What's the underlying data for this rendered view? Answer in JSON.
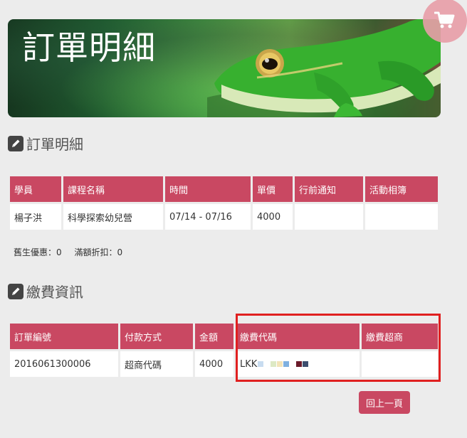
{
  "banner": {
    "title": "訂單明細"
  },
  "order_section": {
    "heading": "訂單明細",
    "columns": [
      "學員",
      "課程名稱",
      "時間",
      "單價",
      "行前通知",
      "活動相簿"
    ],
    "rows": [
      [
        "楊子洪",
        "科學探索幼兒營",
        "07/14 - 07/16",
        "4000",
        "",
        ""
      ]
    ]
  },
  "discounts": {
    "returning_student": "舊生優惠：0",
    "full_amount": "滿額折扣：0"
  },
  "payment_section": {
    "heading": "繳費資訊",
    "columns": [
      "訂單編號",
      "付款方式",
      "金額",
      "繳費代碼",
      "繳費超商"
    ],
    "rows": [
      [
        "2016061300006",
        "超商代碼",
        "4000",
        "LKK",
        ""
      ]
    ]
  },
  "back_button": {
    "label": "回上一頁"
  },
  "colors": {
    "header_bg": "#c94862",
    "highlight": "#e02020",
    "cart_bg": "#e89ea8"
  }
}
